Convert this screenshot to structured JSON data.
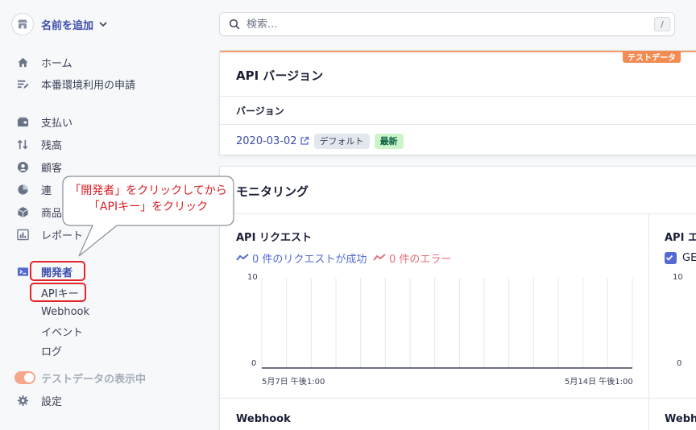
{
  "sidebar": {
    "account_name": "名前を追加",
    "items": [
      {
        "label": "ホーム",
        "icon": "home-icon"
      },
      {
        "label": "本番環境利用の申請",
        "icon": "edit-list-icon"
      },
      {
        "label": "支払い",
        "icon": "wallet-icon"
      },
      {
        "label": "残高",
        "icon": "transfer-icon"
      },
      {
        "label": "顧客",
        "icon": "person-icon"
      },
      {
        "label": "連",
        "icon": "pie-icon"
      },
      {
        "label": "商品",
        "icon": "box-icon"
      },
      {
        "label": "レポート",
        "icon": "bar-chart-icon"
      },
      {
        "label": "開発者",
        "icon": "terminal-icon"
      }
    ],
    "developer_sub": [
      "APIキー",
      "Webhook",
      "イベント",
      "ログ"
    ],
    "test_toggle_label": "テストデータの表示中",
    "settings_label": "設定"
  },
  "callout": {
    "line1": "「開発者」をクリックしてから",
    "line2": "「APIキー」をクリック"
  },
  "search": {
    "placeholder": "検索...",
    "shortcut": "/"
  },
  "api_card": {
    "badge": "テストデータ",
    "title": "API バージョン",
    "column": "バージョン",
    "version": "2020-03-02",
    "tag_default": "デフォルト",
    "tag_latest": "最新"
  },
  "monitoring": {
    "title": "モニタリング",
    "requests_title": "API リクエスト",
    "success_legend": "0 件のリクエストが成功",
    "error_legend": "0 件のエラー",
    "right_title": "API エ",
    "right_checkbox_label": "GE",
    "webhook_title": "Webhook",
    "webhook_right": "Webho"
  },
  "chart_data": {
    "type": "line",
    "y_ticks": [
      "10",
      "0"
    ],
    "x_ticks": [
      "5月7日 午後1:00",
      "5月14日 午後1:00"
    ],
    "right_y_ticks": [
      "10",
      "0"
    ],
    "series": [
      {
        "values": [
          0,
          0,
          0,
          0,
          0,
          0,
          0,
          0,
          0,
          0,
          0,
          0,
          0,
          0,
          0,
          0
        ]
      }
    ],
    "ylim": [
      0,
      10
    ],
    "colors": {
      "success": "#5469d4",
      "error": "#e56f7a",
      "baseline": "#3c4257"
    }
  }
}
